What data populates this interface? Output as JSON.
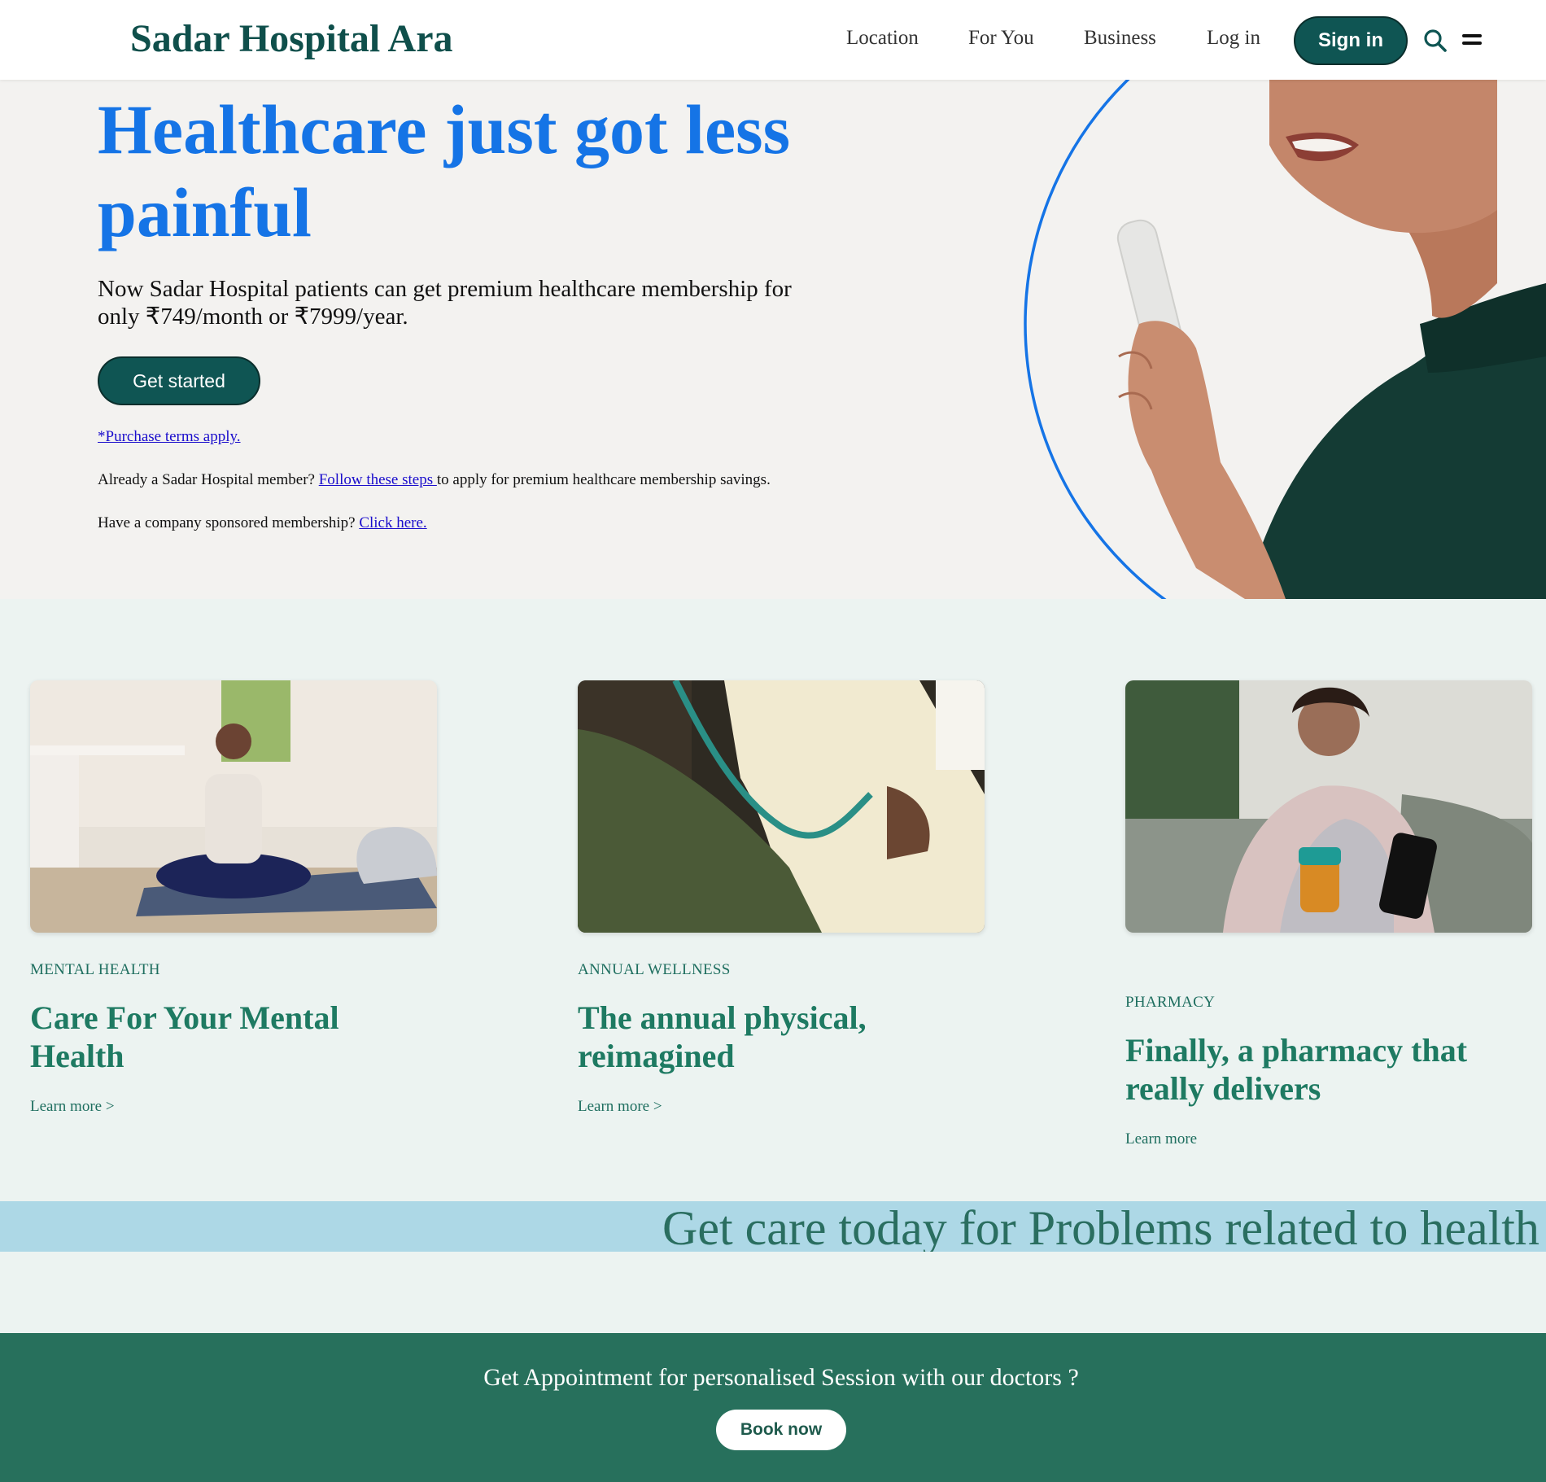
{
  "header": {
    "brand": "Sadar Hospital Ara",
    "nav": [
      "Location",
      "For You",
      "Business",
      "Log in"
    ],
    "sign_in": "Sign in",
    "icons": [
      "search-icon",
      "menu-icon"
    ]
  },
  "hero": {
    "title": "Healthcare just got less painful",
    "subtitle": "Now Sadar Hospital patients can get premium healthcare membership for only ₹749/month or ₹7999/year.",
    "cta": "Get started",
    "terms": "*Purchase terms apply.",
    "member_prefix": "Already a Sadar Hospital member? ",
    "member_link": "Follow these steps ",
    "member_suffix": "to apply for premium healthcare membership savings.",
    "company_prefix": "Have a company sponsored membership? ",
    "company_link": "Click here."
  },
  "cards": [
    {
      "category": "MENTAL HEALTH",
      "title": "Care For Your Mental Health",
      "link": "Learn more >"
    },
    {
      "category": "ANNUAL WELLNESS",
      "title": "The annual physical, reimagined",
      "link": "Learn more >"
    },
    {
      "category": "PHARMACY",
      "title": "Finally, a pharmacy that really delivers",
      "link": "Learn more"
    }
  ],
  "band": {
    "text": "Get care today for Problems related to health"
  },
  "appointment": {
    "text": "Get Appointment for personalised Session with our doctors ?",
    "button": "Book now"
  },
  "colors": {
    "brand_green": "#0f5553",
    "hero_blue": "#1574e6",
    "card_green": "#1e7a62",
    "band_bg": "#add8e6",
    "footer_green": "#27705c"
  }
}
